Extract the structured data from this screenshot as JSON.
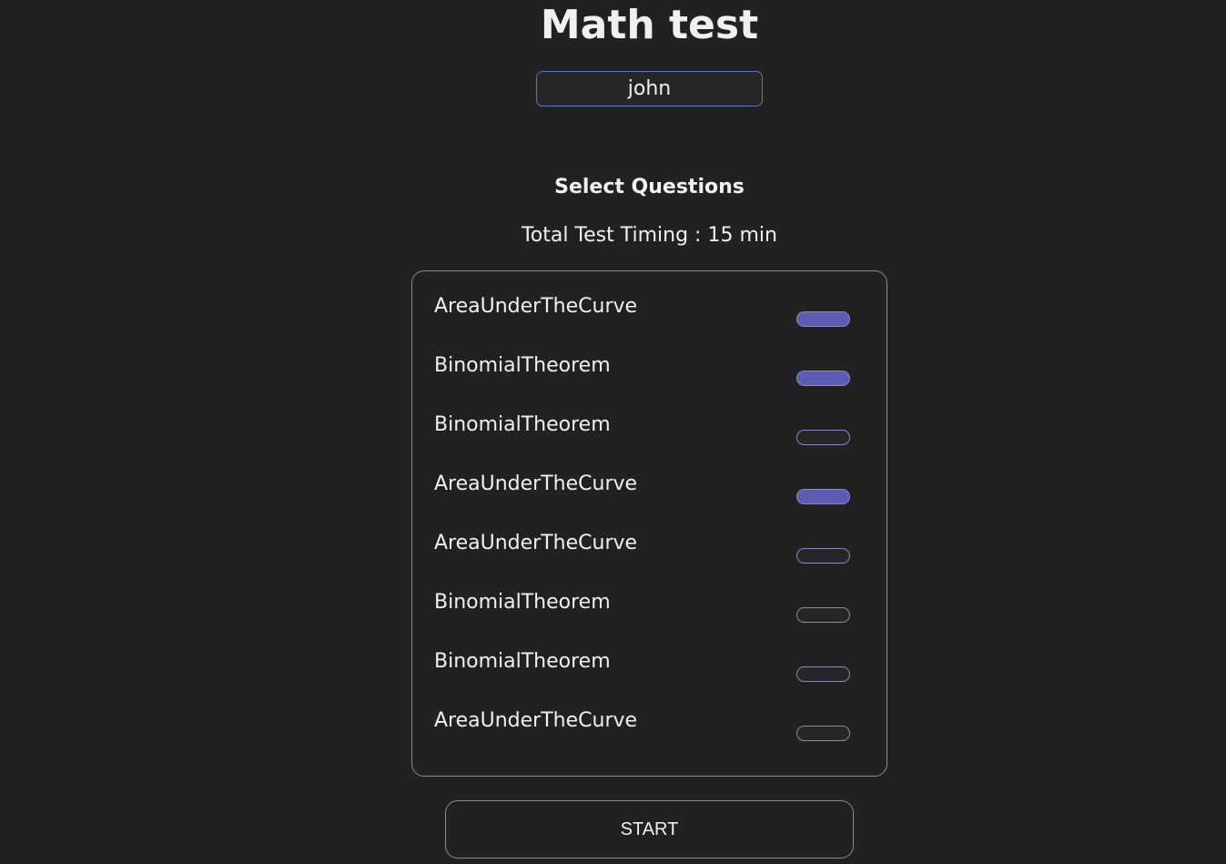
{
  "title": "Math test",
  "name_input": {
    "value": "john"
  },
  "select_heading": "Select Questions",
  "timing": "Total Test Timing : 15 min",
  "questions": [
    {
      "label": "AreaUnderTheCurve",
      "selected": true
    },
    {
      "label": "BinomialTheorem",
      "selected": true
    },
    {
      "label": "BinomialTheorem",
      "selected": false
    },
    {
      "label": "AreaUnderTheCurve",
      "selected": true
    },
    {
      "label": "AreaUnderTheCurve",
      "selected": false
    },
    {
      "label": "BinomialTheorem",
      "selected": false
    },
    {
      "label": "BinomialTheorem",
      "selected": false
    },
    {
      "label": "AreaUnderTheCurve",
      "selected": false
    }
  ],
  "start_label": "START",
  "colors": {
    "accent": "#5d5cb4",
    "background": "#212121"
  }
}
